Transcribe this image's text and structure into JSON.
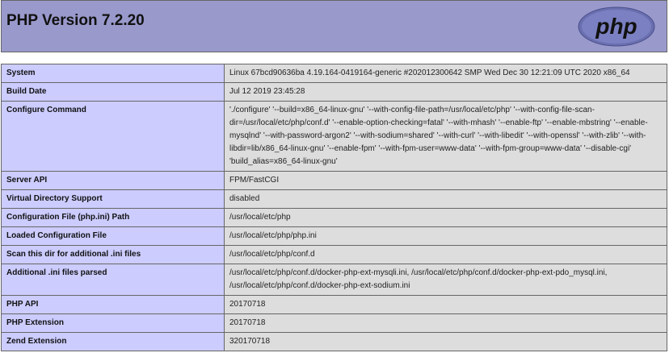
{
  "header": {
    "title": "PHP Version 7.2.20",
    "logo_text": "php"
  },
  "rows": [
    {
      "key": "System",
      "value": "Linux 67bcd90636ba 4.19.164-0419164-generic #202012300642 SMP Wed Dec 30 12:21:09 UTC 2020 x86_64"
    },
    {
      "key": "Build Date",
      "value": "Jul 12 2019 23:45:28"
    },
    {
      "key": "Configure Command",
      "value": "'./configure' '--build=x86_64-linux-gnu' '--with-config-file-path=/usr/local/etc/php' '--with-config-file-scan-dir=/usr/local/etc/php/conf.d' '--enable-option-checking=fatal' '--with-mhash' '--enable-ftp' '--enable-mbstring' '--enable-mysqlnd' '--with-password-argon2' '--with-sodium=shared' '--with-curl' '--with-libedit' '--with-openssl' '--with-zlib' '--with-libdir=lib/x86_64-linux-gnu' '--enable-fpm' '--with-fpm-user=www-data' '--with-fpm-group=www-data' '--disable-cgi' 'build_alias=x86_64-linux-gnu'"
    },
    {
      "key": "Server API",
      "value": "FPM/FastCGI"
    },
    {
      "key": "Virtual Directory Support",
      "value": "disabled"
    },
    {
      "key": "Configuration File (php.ini) Path",
      "value": "/usr/local/etc/php"
    },
    {
      "key": "Loaded Configuration File",
      "value": "/usr/local/etc/php/php.ini"
    },
    {
      "key": "Scan this dir for additional .ini files",
      "value": "/usr/local/etc/php/conf.d"
    },
    {
      "key": "Additional .ini files parsed",
      "value": "/usr/local/etc/php/conf.d/docker-php-ext-mysqli.ini, /usr/local/etc/php/conf.d/docker-php-ext-pdo_mysql.ini, /usr/local/etc/php/conf.d/docker-php-ext-sodium.ini"
    },
    {
      "key": "PHP API",
      "value": "20170718"
    },
    {
      "key": "PHP Extension",
      "value": "20170718"
    },
    {
      "key": "Zend Extension",
      "value": "320170718"
    }
  ]
}
